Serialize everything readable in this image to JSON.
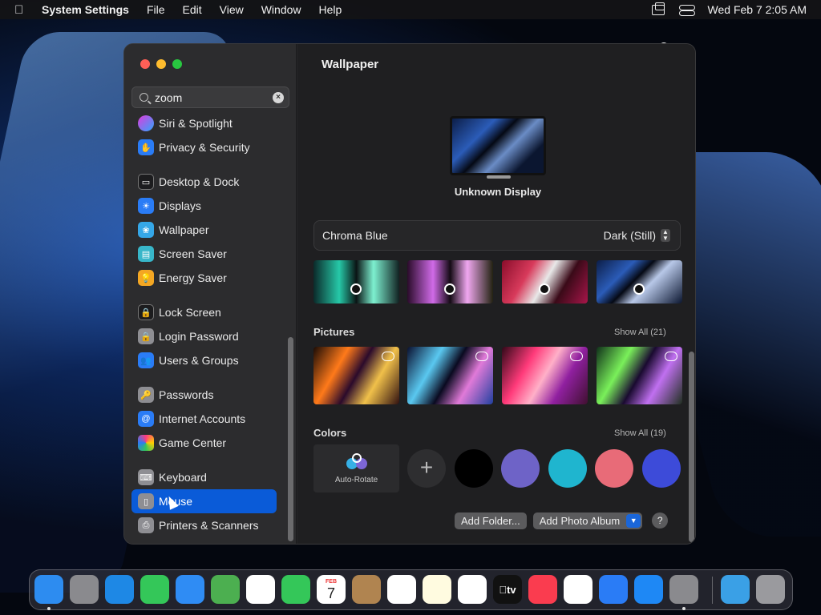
{
  "menubar": {
    "app": "System Settings",
    "items": [
      "File",
      "Edit",
      "View",
      "Window",
      "Help"
    ],
    "clock": "Wed Feb 7  2:05 AM"
  },
  "sidebar": {
    "search_value": "zoom",
    "items": [
      {
        "label": "Siri & Spotlight",
        "icon": "siri-icon",
        "color": "#7b3fe4"
      },
      {
        "label": "Privacy & Security",
        "icon": "hand-icon",
        "color": "#2a7cf6"
      },
      {
        "label": "Desktop & Dock",
        "icon": "dock-icon",
        "color": "#1c1c1e"
      },
      {
        "label": "Displays",
        "icon": "sun-icon",
        "color": "#2a7cf6"
      },
      {
        "label": "Wallpaper",
        "icon": "flower-icon",
        "color": "#35a7e8"
      },
      {
        "label": "Screen Saver",
        "icon": "screensaver-icon",
        "color": "#38b6c9"
      },
      {
        "label": "Energy Saver",
        "icon": "bulb-icon",
        "color": "#f4a723"
      },
      {
        "label": "Lock Screen",
        "icon": "lock-icon",
        "color": "#1c1c1e"
      },
      {
        "label": "Login Password",
        "icon": "lock-icon",
        "color": "#8e8e93"
      },
      {
        "label": "Users & Groups",
        "icon": "users-icon",
        "color": "#2a7cf6"
      },
      {
        "label": "Passwords",
        "icon": "key-icon",
        "color": "#8e8e93"
      },
      {
        "label": "Internet Accounts",
        "icon": "at-icon",
        "color": "#2a7cf6"
      },
      {
        "label": "Game Center",
        "icon": "gamecenter-icon",
        "color": "#ffffff"
      },
      {
        "label": "Keyboard",
        "icon": "keyboard-icon",
        "color": "#8e8e93"
      },
      {
        "label": "Mouse",
        "icon": "mouse-icon",
        "color": "#8e8e93"
      },
      {
        "label": "Printers & Scanners",
        "icon": "printer-icon",
        "color": "#8e8e93"
      }
    ],
    "active": "Mouse"
  },
  "main": {
    "title": "Wallpaper",
    "display_label": "Unknown Display",
    "wallpaper_name": "Chroma Blue",
    "mode": "Dark (Still)",
    "pictures_title": "Pictures",
    "pictures_show_all": "Show All (21)",
    "colors_title": "Colors",
    "colors_show_all": "Show All (19)",
    "auto_rotate": "Auto-Rotate",
    "swatches": [
      "#000000",
      "#6e63c7",
      "#1fb5cf",
      "#e86b78",
      "#3d4bd9"
    ],
    "add_folder": "Add Folder...",
    "add_album": "Add Photo Album",
    "help": "?"
  },
  "dock": {
    "apps": [
      {
        "name": "finder-icon",
        "color": "#2d8cf0"
      },
      {
        "name": "launchpad-icon",
        "color": "#8a8a8e"
      },
      {
        "name": "safari-icon",
        "color": "#1e88e5"
      },
      {
        "name": "messages-icon",
        "color": "#34c759"
      },
      {
        "name": "mail-icon",
        "color": "#2f8cf4"
      },
      {
        "name": "maps-icon",
        "color": "#4caf50"
      },
      {
        "name": "photos-icon",
        "color": "#ffffff"
      },
      {
        "name": "facetime-icon",
        "color": "#34c759"
      },
      {
        "name": "calendar-icon",
        "color": "#ffffff"
      },
      {
        "name": "contacts-icon",
        "color": "#b08450"
      },
      {
        "name": "reminders-icon",
        "color": "#ffffff"
      },
      {
        "name": "notes-icon",
        "color": "#fffbe0"
      },
      {
        "name": "freeform-icon",
        "color": "#ffffff"
      },
      {
        "name": "tv-icon",
        "color": "#111111"
      },
      {
        "name": "music-icon",
        "color": "#fa3c4f"
      },
      {
        "name": "news-icon",
        "color": "#ffffff"
      },
      {
        "name": "keynote-icon",
        "color": "#2a7cf6"
      },
      {
        "name": "appstore-icon",
        "color": "#1e88f5"
      },
      {
        "name": "system-settings-icon",
        "color": "#8a8a8e"
      },
      {
        "name": "downloads-folder-icon",
        "color": "#3aa0e6"
      },
      {
        "name": "trash-icon",
        "color": "#9a9a9e"
      }
    ],
    "calendar_month": "FEB",
    "calendar_day": "7",
    "tv_label": "tv"
  }
}
